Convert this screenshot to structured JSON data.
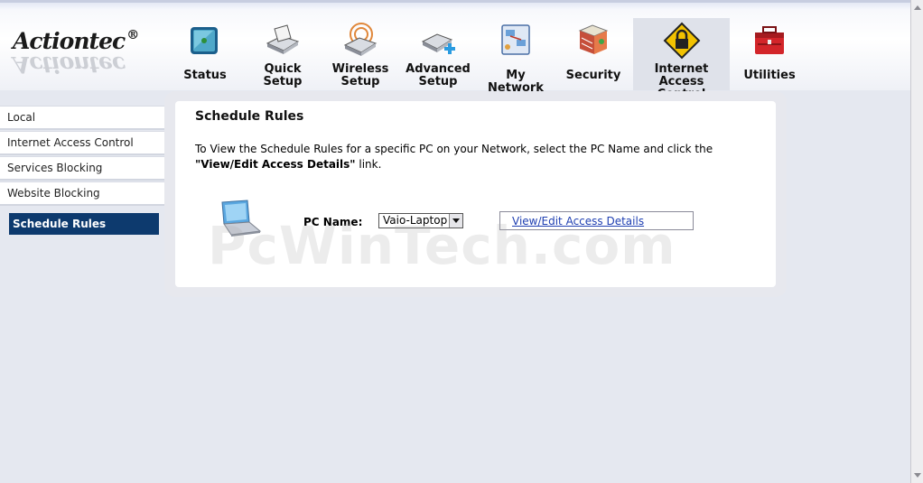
{
  "brand": {
    "logo": "Actiontec",
    "reg": "®"
  },
  "nav": [
    {
      "label": "Status",
      "icon": "status-icon"
    },
    {
      "label": "Quick\nSetup",
      "icon": "quick-setup-icon"
    },
    {
      "label": "Wireless\nSetup",
      "icon": "wireless-setup-icon"
    },
    {
      "label": "Advanced\nSetup",
      "icon": "advanced-setup-icon"
    },
    {
      "label": "My Network",
      "icon": "my-network-icon"
    },
    {
      "label": "Security",
      "icon": "security-icon"
    },
    {
      "label": "Internet Access\nControl",
      "icon": "lock-icon",
      "active": true
    },
    {
      "label": "Utilities",
      "icon": "toolbox-icon"
    }
  ],
  "sidebar": {
    "items": [
      {
        "label": "Local"
      },
      {
        "label": "Internet Access Control"
      },
      {
        "label": "Services Blocking"
      },
      {
        "label": "Website Blocking"
      },
      {
        "label": "Schedule Rules",
        "selected": true
      }
    ]
  },
  "main": {
    "title": "Schedule Rules",
    "instructions_pre": "To View the Schedule Rules for a specific PC on your Network, select the PC Name and click the",
    "instructions_bold": "\"View/Edit Access Details\"",
    "instructions_post": "  link.",
    "pc_label": "PC Name:",
    "pc_selected": "Vaio-Laptop",
    "details_link": "View/Edit Access Details"
  },
  "watermark": "PcWinTech.com",
  "colors": {
    "selected_bg": "#0d3a6e",
    "link": "#1f3fb2"
  }
}
